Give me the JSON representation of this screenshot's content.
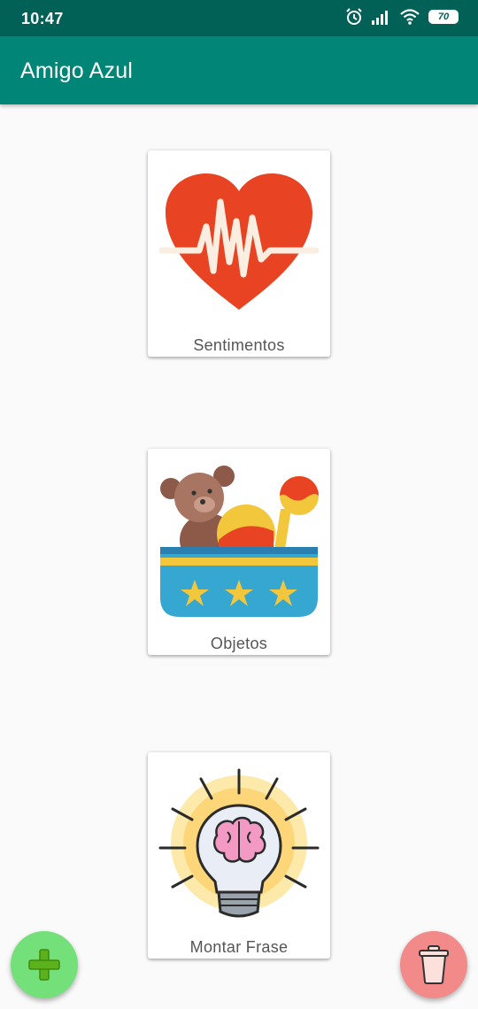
{
  "status_bar": {
    "time": "10:47",
    "battery": "70"
  },
  "app_bar": {
    "title": "Amigo Azul"
  },
  "categories": [
    {
      "label": "Sentimentos",
      "icon": "heart-pulse-icon"
    },
    {
      "label": "Objetos",
      "icon": "toy-box-icon"
    },
    {
      "label": "Montar Frase",
      "icon": "lightbulb-brain-icon"
    }
  ],
  "fabs": {
    "add_icon": "plus-icon",
    "delete_icon": "trash-icon"
  },
  "colors": {
    "status_bar": "#016157",
    "app_bar": "#018577",
    "add_fab": "#74e07a",
    "delete_fab": "#f28a8a"
  }
}
